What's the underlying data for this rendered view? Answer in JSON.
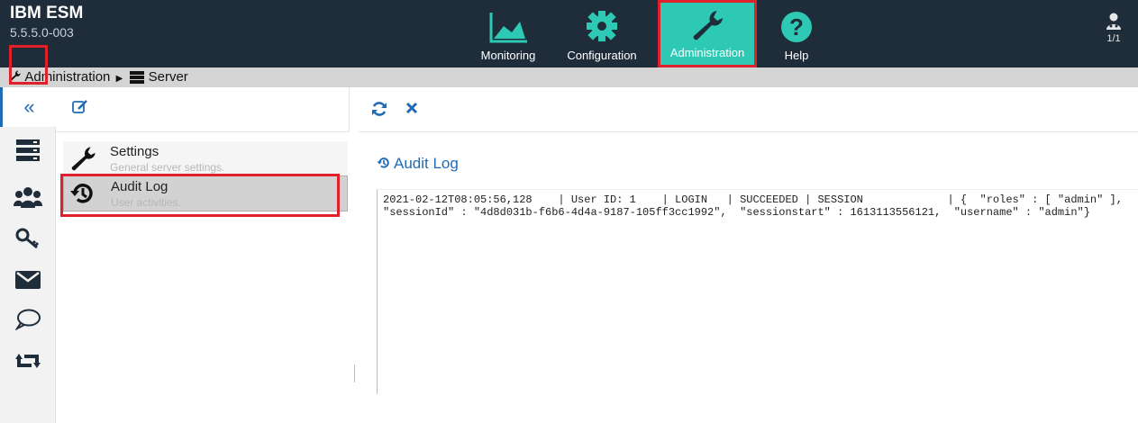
{
  "app": {
    "name": "IBM ESM",
    "version": "5.5.5.0-003"
  },
  "nav": [
    {
      "label": "Monitoring",
      "icon": "area-chart-icon"
    },
    {
      "label": "Configuration",
      "icon": "gear-icon"
    },
    {
      "label": "Administration",
      "icon": "wrench-icon",
      "active": true
    },
    {
      "label": "Help",
      "icon": "question-circle-icon"
    }
  ],
  "user": {
    "sessions": "1/1",
    "icon": "user-icon"
  },
  "breadcrumb": {
    "first": "Administration",
    "second": "Server"
  },
  "sidebar_icons": [
    "collapse-icon",
    "server-icon",
    "users-icon",
    "keys-icon",
    "mail-icon",
    "chat-icon",
    "retweet-icon"
  ],
  "menu": [
    {
      "title": "Settings",
      "subtitle": "General server settings."
    },
    {
      "title": "Audit Log",
      "subtitle": "User activities."
    }
  ],
  "content": {
    "title": "Audit Log",
    "log": "2021-02-12T08:05:56,128    | User ID: 1    | LOGIN   | SUCCEEDED | SESSION             | {  \"roles\" : [ \"admin\" ],  \"sessionId\" : \"4d8d031b-f6b6-4d4a-9187-105ff3cc1992\",  \"sessionstart\" : 1613113556121,  \"username\" : \"admin\"}"
  },
  "colors": {
    "topbar": "#1f2d3b",
    "accent": "#2ec9b4",
    "highlight": "#e0202a",
    "link": "#1f6bb5"
  }
}
